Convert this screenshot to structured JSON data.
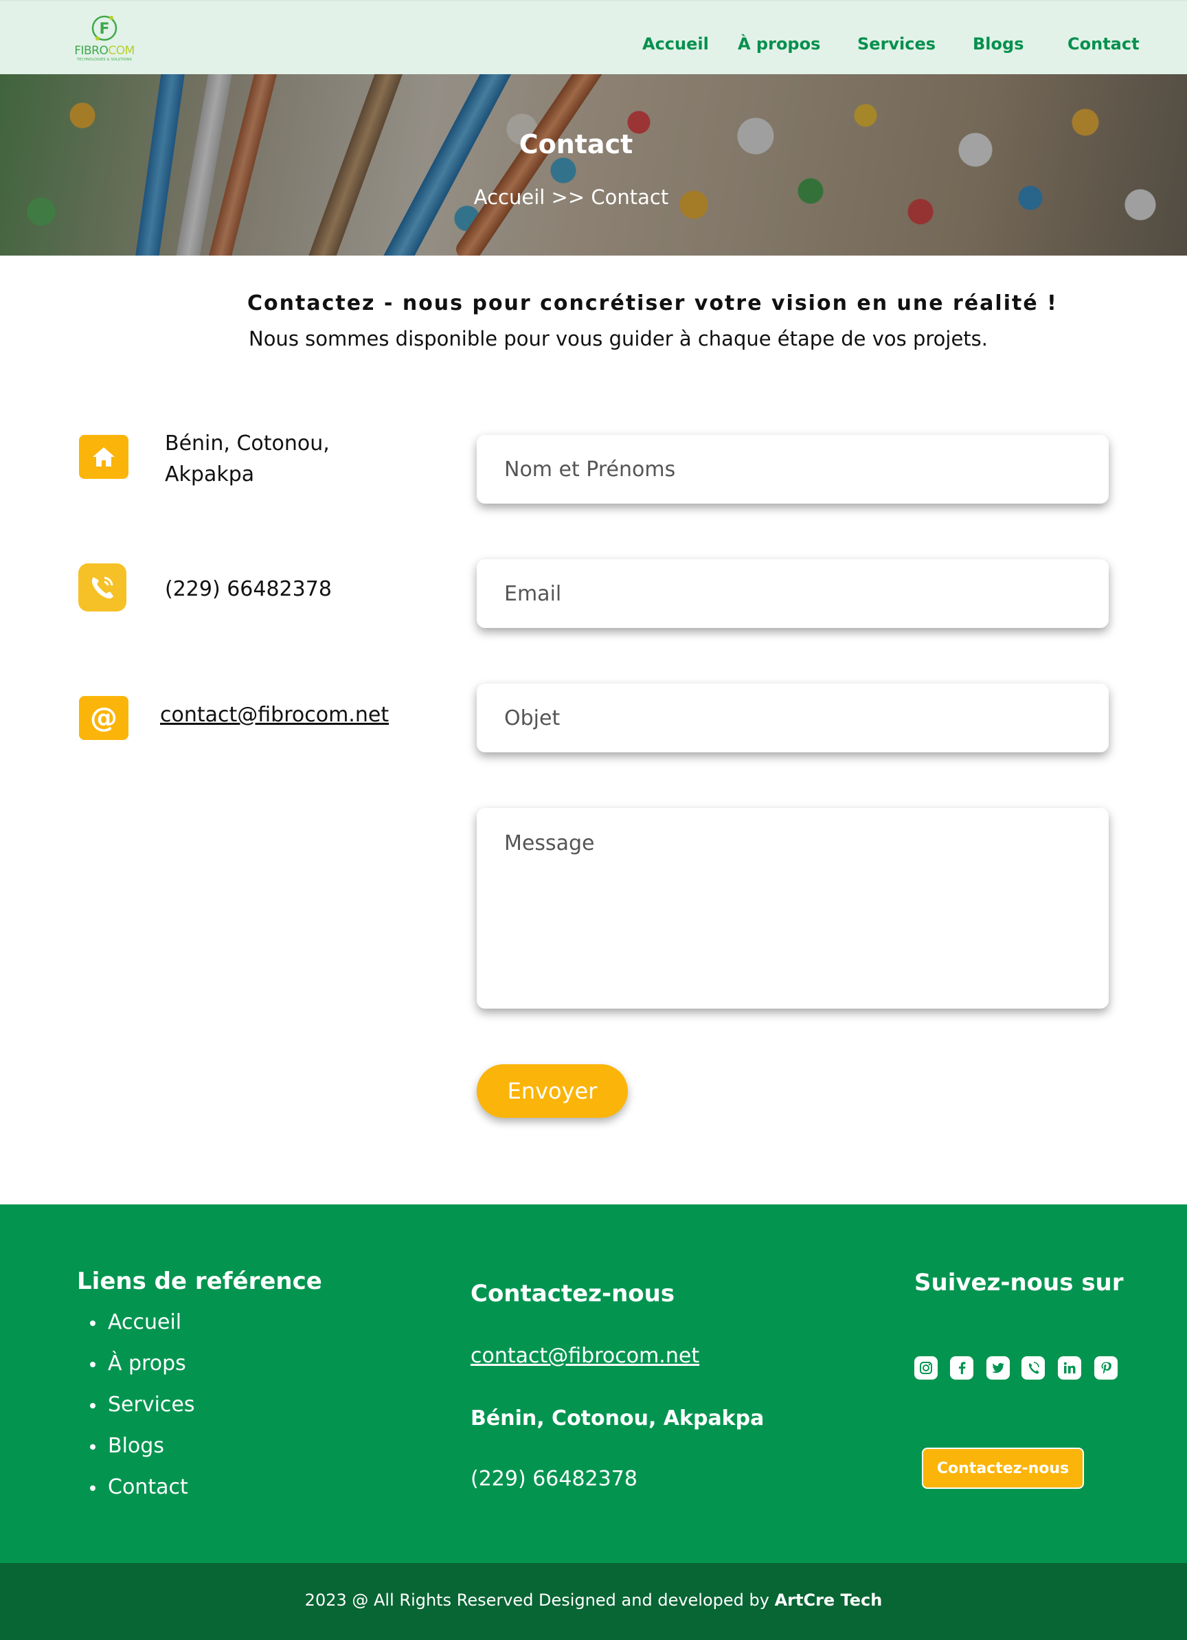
{
  "brand": {
    "logo_text_main": "FIBRO",
    "logo_text_accent": "COM",
    "logo_tagline": "TECHNOLOGIES & SOLUTIONS",
    "logo_letter": "F"
  },
  "nav": {
    "items": [
      "Accueil",
      "À propos",
      "Services",
      "Blogs",
      "Contact"
    ]
  },
  "hero": {
    "title": "Contact",
    "breadcrumb": "Accueil >> Contact"
  },
  "intro": {
    "title": "Contactez - nous pour concrétiser votre vision en une réalité !",
    "subtitle": "Nous sommes disponible pour vous guider à chaque étape de vos projets."
  },
  "contact_info": {
    "address_line1": "Bénin, Cotonou,",
    "address_line2": "Akpakpa",
    "phone": "(229) 66482378",
    "email": "contact@fibrocom.net",
    "icons": [
      "home-icon",
      "phone-icon",
      "at-icon"
    ]
  },
  "form": {
    "name_placeholder": "Nom et Prénoms",
    "email_placeholder": "Email",
    "subject_placeholder": "Objet",
    "message_placeholder": "Message",
    "submit_label": "Envoyer"
  },
  "footer": {
    "links_title": "Liens de reférence",
    "links": [
      "Accueil",
      "À props",
      "Services",
      "Blogs",
      "Contact"
    ],
    "contact_title": "Contactez-nous",
    "contact_email": "contact@fibrocom.net",
    "contact_address": "Bénin, Cotonou, Akpakpa",
    "contact_phone": "(229) 66482378",
    "social_title": "Suivez-nous sur",
    "social_icons": [
      "instagram-icon",
      "facebook-icon",
      "twitter-icon",
      "viber-icon",
      "linkedin-icon",
      "pinterest-icon"
    ],
    "cta_label": "Contactez-nous"
  },
  "copyright": {
    "text": "2023 @ All Rights Reserved Designed and developed by ",
    "company": "ArtCre Tech"
  },
  "colors": {
    "primary_green": "#039550",
    "dark_green": "#086534",
    "accent_yellow": "#fbb409",
    "header_bg": "#e2f2e8",
    "nav_green": "#06904e"
  }
}
